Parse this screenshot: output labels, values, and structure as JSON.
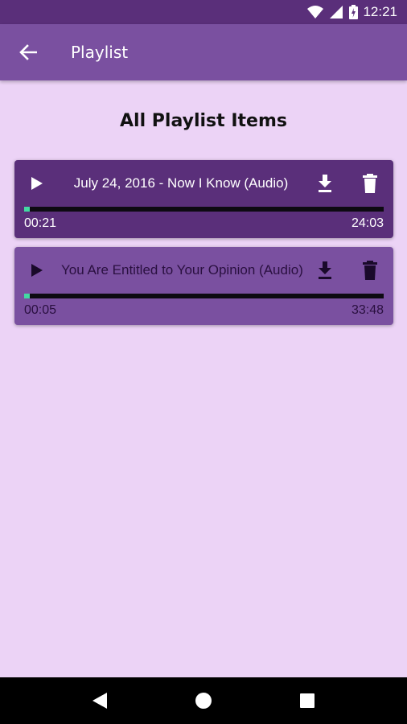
{
  "status_bar": {
    "time": "12:21",
    "icons": [
      "wifi-icon",
      "cellular-signal-icon",
      "battery-icon"
    ]
  },
  "app_bar": {
    "back_icon": "arrow-left-icon",
    "title": "Playlist"
  },
  "heading": "All Playlist Items",
  "colors": {
    "status_bar": "#5a2f7a",
    "app_bar": "#7a50a0",
    "background": "#ecd3f6",
    "active_card": "#5a2f7a",
    "inactive_card": "#7a50a0",
    "progress_fill": "#43d9a3",
    "progress_track": "#0d0a12"
  },
  "playlist": [
    {
      "title": "July 24, 2016 - Now I Know (Audio)",
      "elapsed": "00:21",
      "duration": "24:03",
      "progress_fraction": 0.015,
      "state": "active",
      "icons": [
        "play-icon",
        "download-icon",
        "trash-icon"
      ]
    },
    {
      "title": "You Are Entitled to Your Opinion (Audio)",
      "elapsed": "00:05",
      "duration": "33:48",
      "progress_fraction": 0.003,
      "state": "inactive",
      "icons": [
        "play-icon",
        "download-icon",
        "trash-icon"
      ]
    }
  ],
  "nav_bar": {
    "icons": [
      "back-triangle-icon",
      "home-circle-icon",
      "recents-square-icon"
    ]
  }
}
